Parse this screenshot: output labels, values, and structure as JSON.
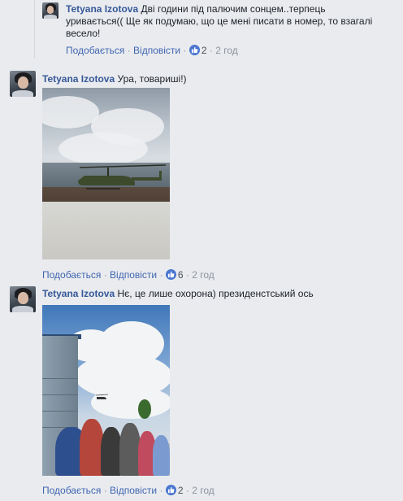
{
  "comments": [
    {
      "author": "Tetyana Izotova",
      "text": "Дві години під палючим сонцем..терпець уривається(( Ще як подумаю, що це мені писати в номер, то взагалі весело!",
      "like_label": "Подобається",
      "reply_label": "Відповісти",
      "likes": "2",
      "time": "2 год"
    },
    {
      "author": "Tetyana Izotova",
      "text": "Ура, товариші!)",
      "like_label": "Подобається",
      "reply_label": "Відповісти",
      "likes": "6",
      "time": "2 год"
    },
    {
      "author": "Tetyana Izotova",
      "text": "Нє, це лише охорона) президенстський ось",
      "like_label": "Подобається",
      "reply_label": "Відповісти",
      "likes": "2",
      "time": "2 год"
    }
  ],
  "separator": "·",
  "icons": {
    "like": "thumbs-up-icon"
  },
  "colors": {
    "name": "#365899",
    "link": "#4267b2",
    "meta": "#8d949e",
    "like_badge": "#4a76d0",
    "background": "#e9ebee"
  }
}
